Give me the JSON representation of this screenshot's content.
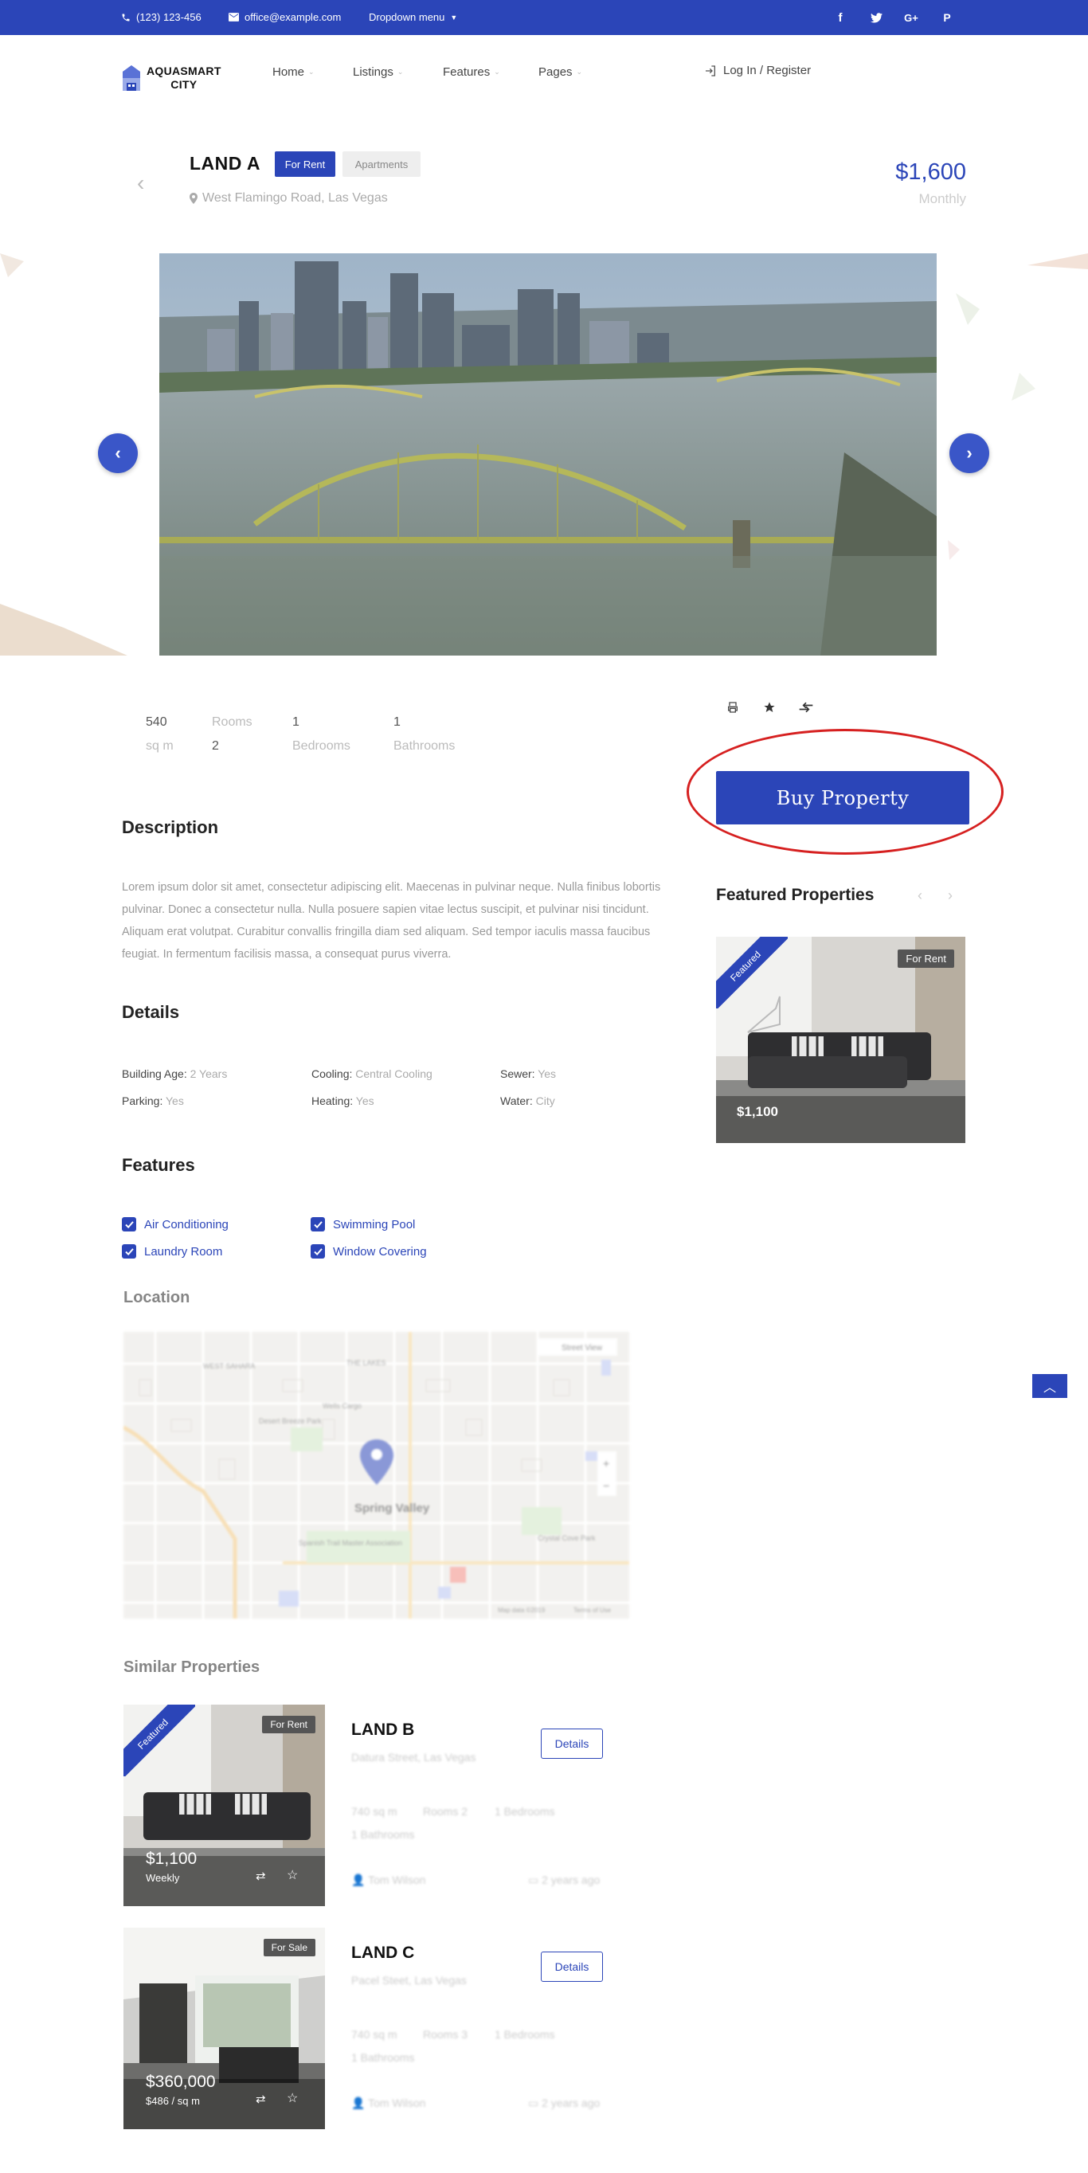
{
  "topbar": {
    "phone": "(123) 123-456",
    "email": "office@example.com",
    "dropdown": "Dropdown menu",
    "social": [
      "f",
      "t",
      "G+",
      "P"
    ]
  },
  "header": {
    "logo_line1": "AQUASMART",
    "logo_line2": "CITY",
    "nav": [
      "Home",
      "Listings",
      "Features",
      "Pages"
    ],
    "login": "Log In / Register"
  },
  "property": {
    "title": "LAND A",
    "badge_status": "For Rent",
    "badge_type": "Apartments",
    "address": "West Flamingo Road, Las Vegas",
    "price": "$1,600",
    "period": "Monthly"
  },
  "stats": [
    {
      "value": "540",
      "label": "sq m"
    },
    {
      "value": "Rooms",
      "label": "2"
    },
    {
      "value": "1",
      "label": "Bedrooms"
    },
    {
      "value": "1",
      "label": "Bathrooms"
    }
  ],
  "actions": {
    "print": "print-icon",
    "favorite": "star-icon",
    "compare": "compare-icon",
    "buy": "Buy Property"
  },
  "description": {
    "heading": "Description",
    "text": "Lorem ipsum dolor sit amet, consectetur adipiscing elit. Maecenas in pulvinar neque. Nulla finibus lobortis pulvinar. Donec a consectetur nulla. Nulla posuere sapien vitae lectus suscipit, et pulvinar nisi tincidunt. Aliquam erat volutpat. Curabitur convallis fringilla diam sed aliquam. Sed tempor iaculis massa faucibus feugiat. In fermentum facilisis massa, a consequat purus viverra."
  },
  "details": {
    "heading": "Details",
    "items": [
      {
        "label": "Building Age:",
        "value": "2 Years"
      },
      {
        "label": "Cooling:",
        "value": "Central Cooling"
      },
      {
        "label": "Sewer:",
        "value": "Yes"
      },
      {
        "label": "Parking:",
        "value": "Yes"
      },
      {
        "label": "Heating:",
        "value": "Yes"
      },
      {
        "label": "Water:",
        "value": "City"
      }
    ]
  },
  "features": {
    "heading": "Features",
    "items": [
      "Air Conditioning",
      "Swimming Pool",
      "Laundry Room",
      "Window Covering"
    ]
  },
  "location": {
    "heading": "Location",
    "street_view": "Street View",
    "labels": [
      "WEST SAHARA",
      "THE LAKES",
      "Wells Cargo",
      "Desert Breeze Park",
      "Spring Valley",
      "Spanish Trail Master Association",
      "Crystal Cove Park"
    ],
    "map_data": "Map data ©2019",
    "terms": "Terms of Use",
    "zoom_in": "+",
    "zoom_out": "−"
  },
  "featured": {
    "heading": "Featured Properties",
    "ribbon": "Featured",
    "tag": "For Rent",
    "price": "$1,100"
  },
  "similar": {
    "heading": "Similar Properties",
    "items": [
      {
        "ribbon": "Featured",
        "tag": "For Rent",
        "price": "$1,100",
        "sub": "Weekly",
        "title": "LAND B",
        "address": "Datura Street, Las Vegas",
        "size": "740 sq m",
        "rooms": "Rooms 2",
        "bedrooms": "1 Bedrooms",
        "bathrooms": "1 Bathrooms",
        "agent": "Tom Wilson",
        "date": "2 years ago",
        "button": "Details"
      },
      {
        "ribbon": "",
        "tag": "For Sale",
        "price": "$360,000",
        "sub": "$486 / sq m",
        "title": "LAND C",
        "address": "Pacel Steet, Las Vegas",
        "size": "740 sq m",
        "rooms": "Rooms 3",
        "bedrooms": "1 Bedrooms",
        "bathrooms": "1 Bathrooms",
        "agent": "Tom Wilson",
        "date": "2 years ago",
        "button": "Details"
      }
    ]
  },
  "colors": {
    "accent": "#2b45b8",
    "highlight_ring": "#d62020"
  }
}
